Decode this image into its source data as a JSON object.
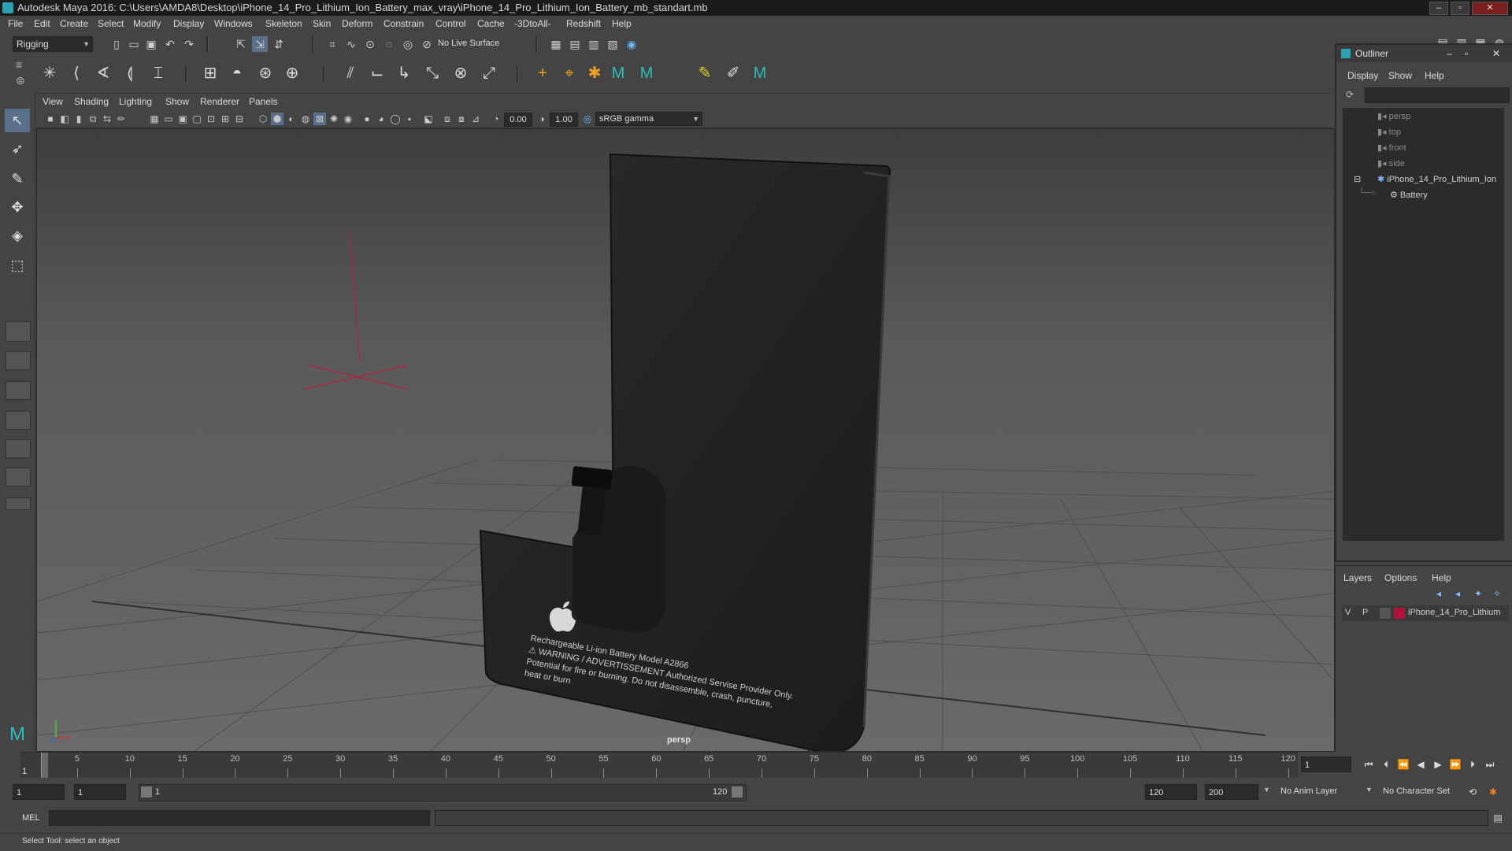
{
  "window": {
    "title": "Autodesk Maya 2016: C:\\Users\\AMDA8\\Desktop\\iPhone_14_Pro_Lithium_Ion_Battery_max_vray\\iPhone_14_Pro_Lithium_Ion_Battery_mb_standart.mb"
  },
  "menubar": [
    "File",
    "Edit",
    "Create",
    "Select",
    "Modify",
    "Display",
    "Windows",
    "Skeleton",
    "Skin",
    "Deform",
    "Constrain",
    "Control",
    "Cache",
    "-3DtoAll-",
    "Redshift",
    "Help"
  ],
  "statusline": {
    "menuset": "Rigging",
    "live_surface": "No Live Surface"
  },
  "viewport": {
    "menu": [
      "View",
      "Shading",
      "Lighting",
      "Show",
      "Renderer",
      "Panels"
    ],
    "exposure": "0.00",
    "gamma": "1.00",
    "color_space": "sRGB gamma",
    "camera_label": "persp"
  },
  "model": {
    "label_line1": "Rechargeable Li-ion Battery Model A2866",
    "label_line2": "WARNING / ADVERTISSEMENT Authorized Servise Provider Only.",
    "label_line3": "Potential for fire or burning. Do not disassemble, crash, puncture,",
    "label_line4": "heat or burn"
  },
  "outliner": {
    "title": "Outliner",
    "menu": [
      "Display",
      "Show",
      "Help"
    ],
    "items": [
      "persp",
      "top",
      "front",
      "side",
      "iPhone_14_Pro_Lithium_Ion",
      "Battery"
    ]
  },
  "layers": {
    "menu": [
      "Layers",
      "Options",
      "Help"
    ],
    "row": {
      "v": "V",
      "p": "P",
      "name": "iPhone_14_Pro_Lithium",
      "color": "#b0123a"
    }
  },
  "timeline": {
    "ticks": [
      "5",
      "10",
      "15",
      "20",
      "25",
      "30",
      "35",
      "40",
      "45",
      "50",
      "55",
      "60",
      "65",
      "70",
      "75",
      "80",
      "85",
      "90",
      "95",
      "100",
      "105",
      "110",
      "115",
      "120"
    ],
    "start_label": "1",
    "current_frame": "1"
  },
  "range": {
    "start": "1",
    "anim_start": "1",
    "slider_start": "1",
    "slider_end": "120",
    "anim_end": "120",
    "end": "200",
    "anim_layer": "No Anim Layer",
    "char_set": "No Character Set"
  },
  "cmdline": {
    "lang": "MEL"
  },
  "helpline": {
    "text": "Select Tool: select an object"
  }
}
